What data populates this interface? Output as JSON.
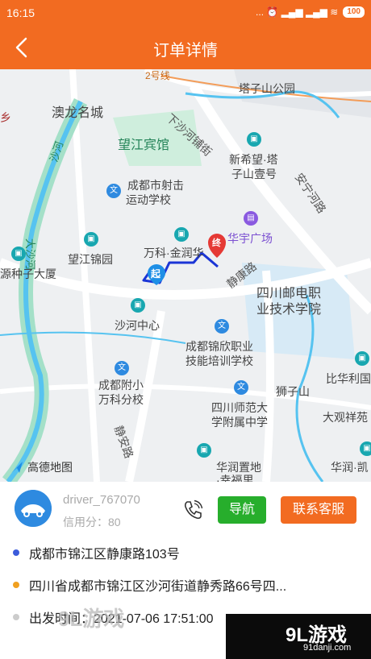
{
  "status_bar": {
    "time": "16:15",
    "icons_text": "... ⏰ ▂▄▆ ▂▄▆ ≋",
    "battery": "100"
  },
  "header": {
    "title": "订单详情"
  },
  "map": {
    "labels": [
      "2号线",
      "塔子山公园",
      "澳龙名城",
      "下沙河铺街",
      "望江宾馆",
      "新希望·塔",
      "子山壹号",
      "成都市射击",
      "运动学校",
      "安宁河路",
      "沙河",
      "大沙河",
      "华宇广场",
      "望江锦园",
      "万科·金润华",
      "静康路",
      "四川邮电职",
      "业技术学院",
      "源种子大厦",
      "沙河中心",
      "成都锦欣职业",
      "技能培训学校",
      "狮子山",
      "比华利国",
      "成都附小",
      "万科分校",
      "四川师范大",
      "学附属中学",
      "大观祥苑",
      "静安路",
      "华润置地",
      "·幸福里",
      "华润·凯",
      "乡"
    ],
    "route_markers": {
      "start": "起",
      "end": "终"
    },
    "attribution": "高德地图"
  },
  "driver": {
    "name": "driver_767070",
    "credit": "信用分：80"
  },
  "buttons": {
    "navigate": "导航",
    "contact": "联系客服"
  },
  "addresses": {
    "start": "成都市锦江区静康路103号",
    "end": "四川省成都市锦江区沙河街道静秀路66号四...",
    "departure": "出发时间：2021-07-06 17:51:00"
  },
  "watermark": {
    "left": "9L游戏",
    "right_big": "9L游戏",
    "right_small": "91danji.com"
  },
  "colors": {
    "brand": "#f26b21",
    "nav_button": "#27ae2c",
    "route": "#1a35d6",
    "start_dot": "#3b5bdb",
    "end_dot": "#f0a020",
    "time_dot": "#cccccc"
  }
}
